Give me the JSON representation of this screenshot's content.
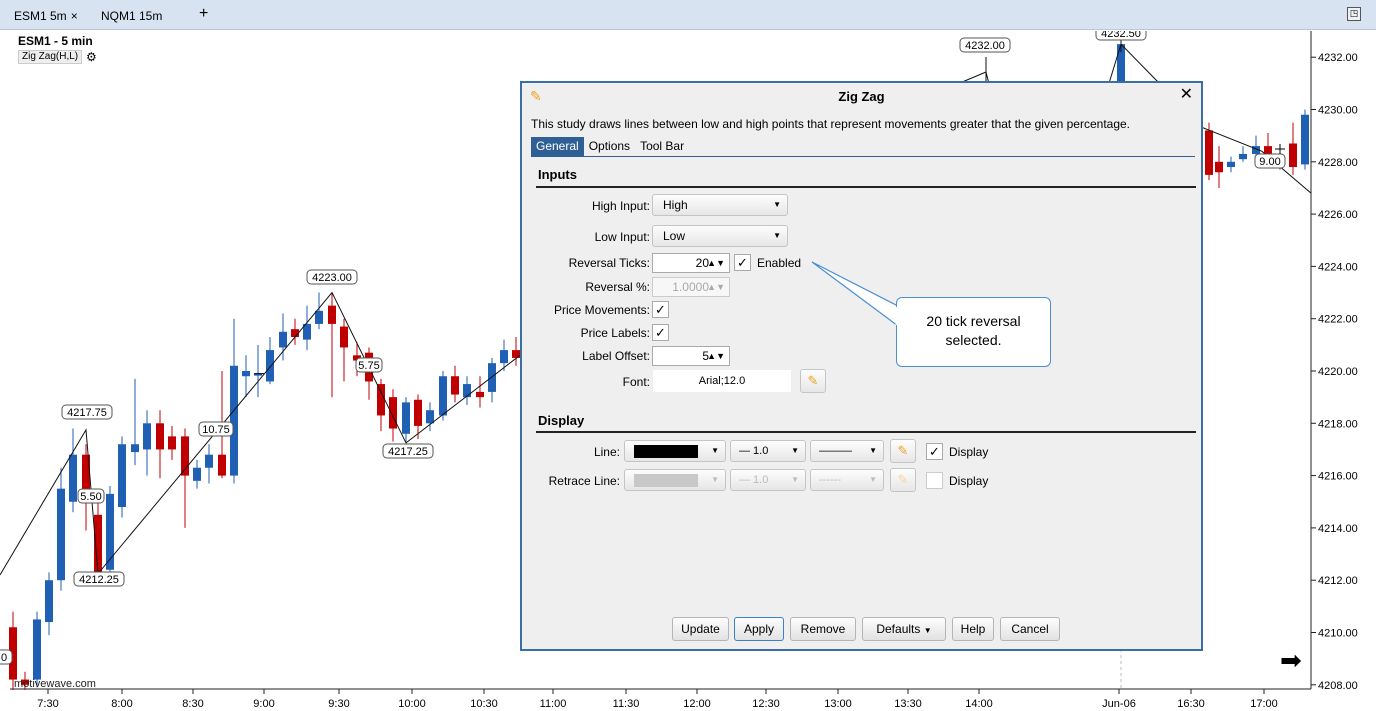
{
  "tabs": [
    {
      "label": "ESM1 5m",
      "close": "×"
    },
    {
      "label": "NQM1 15m"
    }
  ],
  "tab_add": "+",
  "maximize_icon": "◳",
  "chart": {
    "title": "ESM1 - 5 min",
    "study_chip": "Zig Zag(H,L)",
    "watermark": "motivewave.com",
    "price_labels": [
      "4232.00",
      "4230.00",
      "4228.00",
      "4226.00",
      "4224.00",
      "4222.00",
      "4220.00",
      "4218.00",
      "4216.00",
      "4214.00",
      "4212.00",
      "4210.00",
      "4208.00"
    ],
    "time_labels": [
      "7:30",
      "8:00",
      "8:30",
      "9:00",
      "9:30",
      "10:00",
      "10:30",
      "11:00",
      "11:30",
      "12:00",
      "12:30",
      "13:00",
      "13:30",
      "14:00",
      "Jun-06",
      "16:30",
      "17:00"
    ],
    "pivot_labels": [
      "4217.75",
      "4212.25",
      "4223.00",
      "4217.25",
      "4232.00",
      "4232.50"
    ],
    "swing_labels": [
      "5.50",
      "10.75",
      "5.75",
      "9.00"
    ],
    "edge_label": "0",
    "colors": {
      "up": "#1f5fb4",
      "down": "#c00000",
      "line": "#111111"
    }
  },
  "dialog": {
    "title": "Zig Zag",
    "close": "✕",
    "description": "This study draws lines between low and high points that represent movements greater that the given percentage.",
    "tabs": [
      "General",
      "Options",
      "Tool Bar"
    ],
    "active_tab": "General",
    "inputs_title": "Inputs",
    "high_input_label": "High Input:",
    "high_input_value": "High",
    "low_input_label": "Low Input:",
    "low_input_value": "Low",
    "reversal_ticks_label": "Reversal Ticks:",
    "reversal_ticks_value": "20",
    "enabled_label": "Enabled",
    "reversal_pct_label": "Reversal %:",
    "reversal_pct_value": "1.0000",
    "price_movements_label": "Price Movements:",
    "price_labels_label": "Price Labels:",
    "label_offset_label": "Label Offset:",
    "label_offset_value": "5",
    "font_label": "Font:",
    "font_value": "Arial;12.0",
    "display_title": "Display",
    "line_label": "Line:",
    "line_width": "— 1.0",
    "line_style": "———",
    "retrace_label": "Retrace Line:",
    "retrace_width": "— 1.0",
    "retrace_style": "------",
    "display_label": "Display",
    "buttons": {
      "update": "Update",
      "apply": "Apply",
      "remove": "Remove",
      "defaults": "Defaults",
      "help": "Help",
      "cancel": "Cancel"
    }
  },
  "callout": {
    "line1": "20 tick reversal",
    "line2": "selected."
  }
}
